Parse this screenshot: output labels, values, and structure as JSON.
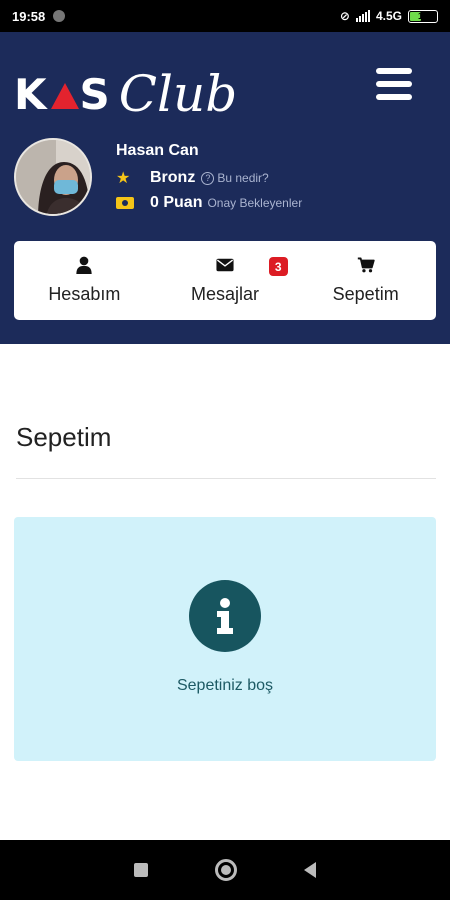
{
  "status_bar": {
    "time": "19:58",
    "network": "4.5G",
    "battery": "19"
  },
  "brand": {
    "kas": "KAS",
    "club": "Club",
    "accent_color": "#e3232e",
    "header_color": "#1c2b5a"
  },
  "user": {
    "name": "Hasan Can",
    "rank": "Bronz",
    "rank_help": "Bu nedir?",
    "points": "0 Puan",
    "points_note": "Onay Bekleyenler"
  },
  "nav": {
    "items": [
      {
        "label": "Hesabım",
        "icon": "user-icon"
      },
      {
        "label": "Mesajlar",
        "icon": "envelope-icon",
        "badge": "3"
      },
      {
        "label": "Sepetim",
        "icon": "cart-icon"
      }
    ]
  },
  "page": {
    "title": "Sepetim"
  },
  "alert": {
    "icon": "info-icon",
    "text": "Sepetiniz boş"
  }
}
